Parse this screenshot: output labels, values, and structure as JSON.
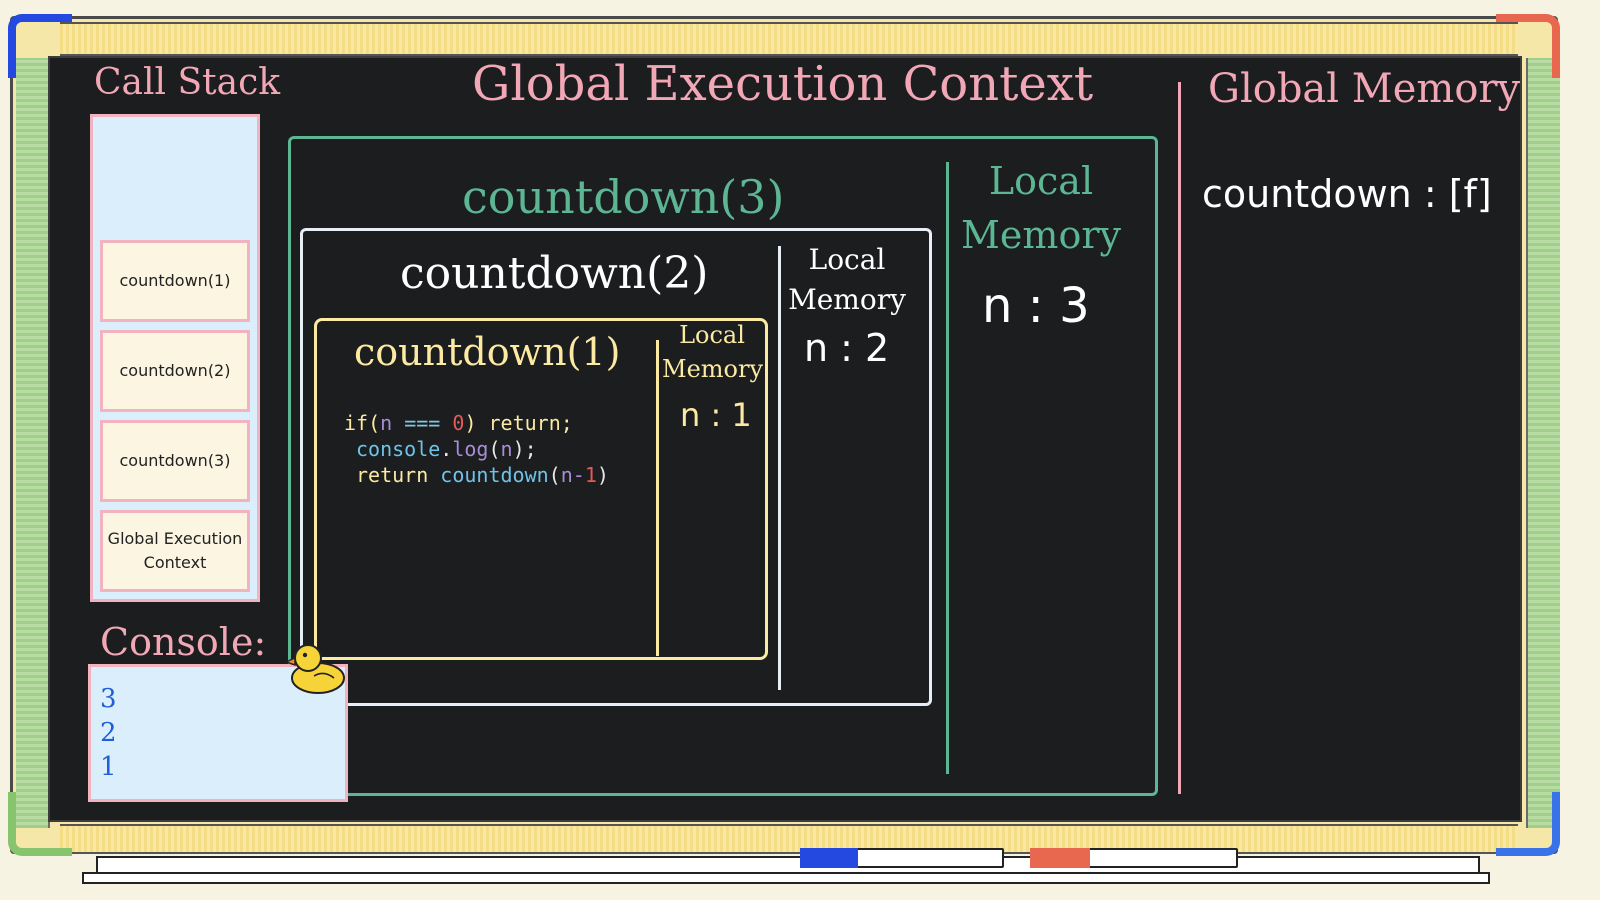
{
  "call_stack": {
    "title": "Call Stack",
    "frames": [
      "countdown(1)",
      "countdown(2)",
      "countdown(3)",
      "Global Execution Context"
    ]
  },
  "global_execution_context": {
    "title": "Global Execution Context"
  },
  "global_memory": {
    "title": "Global Memory",
    "entry": "countdown : [f]"
  },
  "contexts": {
    "countdown3": {
      "title": "countdown(3)",
      "memory_title": "Local Memory",
      "memory_value": "n : 3"
    },
    "countdown2": {
      "title": "countdown(2)",
      "memory_title": "Local Memory",
      "memory_value": "n : 2"
    },
    "countdown1": {
      "title": "countdown(1)",
      "memory_title": "Local Memory",
      "memory_value": "n : 1"
    }
  },
  "code": {
    "line1": {
      "t1": "if(",
      "t2": "n",
      "t3": " === ",
      "t4": "0",
      "t5": ") return;"
    },
    "line2": {
      "t1": "console",
      "t2": ".",
      "t3": "log",
      "t4": "(",
      "t5": "n",
      "t6": ");"
    },
    "line3": {
      "t1": "return ",
      "t2": "countdown",
      "t3": "(",
      "t4": "n-",
      "t5": "1",
      "t6": ")"
    }
  },
  "console": {
    "title": "Console:",
    "lines": [
      "3",
      "2",
      "1"
    ]
  },
  "colors": {
    "board": "#1b1d1e",
    "pink": "#f1a7b6",
    "green": "#5cb694",
    "yellow": "#fce9a2",
    "console_text": "#1f5fd8"
  },
  "icons": {
    "mascot": "rubber-duck-icon"
  }
}
